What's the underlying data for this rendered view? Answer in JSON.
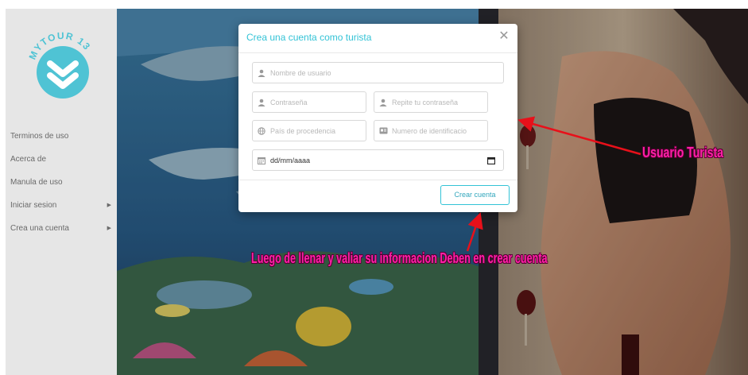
{
  "sidebar": {
    "logo": {
      "text": "MYTOUR 13",
      "color": "#4fc3d4"
    },
    "items": [
      {
        "label": "Terminos de uso",
        "has_submenu": false
      },
      {
        "label": "Acerca de",
        "has_submenu": false
      },
      {
        "label": "Manula de uso",
        "has_submenu": false
      },
      {
        "label": "Iniciar sesion",
        "has_submenu": true
      },
      {
        "label": "Crea una cuenta",
        "has_submenu": true
      }
    ]
  },
  "modal": {
    "title": "Crea una cuenta como turista",
    "fields": {
      "username": {
        "placeholder": "Nombre de usuario",
        "icon": "user-icon"
      },
      "password": {
        "placeholder": "Contraseña",
        "icon": "user-icon"
      },
      "password_repeat": {
        "placeholder": "Repite tu contraseña",
        "icon": "user-icon"
      },
      "country": {
        "placeholder": "País de procedencia",
        "icon": "globe-icon"
      },
      "id_number": {
        "placeholder": "Numero de identificacio",
        "icon": "id-card-icon"
      },
      "birthdate": {
        "value": "dd/mm/aaaa",
        "icon": "calendar-icon"
      }
    },
    "submit_label": "Crear cuenta"
  },
  "annotations": {
    "turista": "Usuario Turista",
    "luego": "Luego de llenar y valiar su informacion Deben en crear cuenta",
    "color": "#ff1fa8"
  },
  "colors": {
    "accent": "#33c3d6",
    "sidebar_bg": "#e6e6e6"
  }
}
